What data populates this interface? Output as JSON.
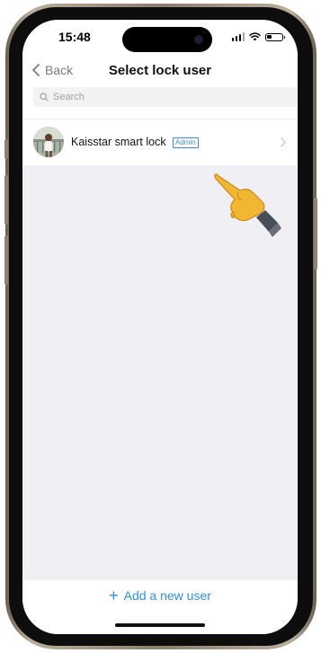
{
  "status_bar": {
    "time": "15:48",
    "icons": [
      "signal-icon",
      "wifi-icon",
      "battery-icon"
    ],
    "battery_level": 0.35
  },
  "nav": {
    "back_label": "Back",
    "title": "Select lock user"
  },
  "search": {
    "placeholder": "Search",
    "value": ""
  },
  "users": [
    {
      "name": "Kaisstar smart lock",
      "role_badge": "Admin"
    }
  ],
  "bottom": {
    "add_label": "Add a new user",
    "add_icon": "+"
  },
  "colors": {
    "accent": "#2f8ee6",
    "badge": "#3a8dde",
    "background": "#efeff4"
  }
}
